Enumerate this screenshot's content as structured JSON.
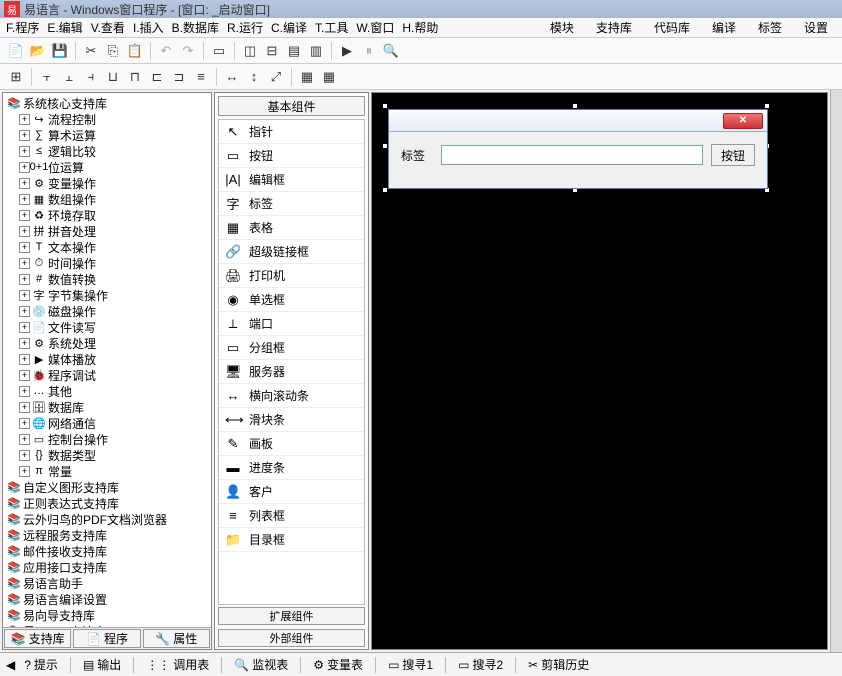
{
  "title": "易语言 - Windows窗口程序 - [窗口: _启动窗口]",
  "menu": [
    "F.程序",
    "E.编辑",
    "V.查看",
    "I.插入",
    "B.数据库",
    "R.运行",
    "C.编译",
    "T.工具",
    "W.窗口",
    "H.帮助"
  ],
  "menu_right": [
    "模块",
    "支持库",
    "代码库",
    "编译",
    "标签",
    "设置"
  ],
  "left_root": "系统核心支持库",
  "left_children": [
    "流程控制",
    "算术运算",
    "逻辑比较",
    "位运算",
    "变量操作",
    "数组操作",
    "环境存取",
    "拼音处理",
    "文本操作",
    "时间操作",
    "数值转换",
    "字节集操作",
    "磁盘操作",
    "文件读写",
    "系统处理",
    "媒体播放",
    "程序调试",
    "其他",
    "数据库",
    "网络通信",
    "控制台操作",
    "数据类型",
    "常量"
  ],
  "left_libs": [
    "自定义图形支持库",
    "正则表达式支持库",
    "云外归鸟的PDF文档浏览器",
    "远程服务支持库",
    "邮件接收支持库",
    "应用接口支持库",
    "易语言助手",
    "易语言编译设置",
    "易向导支持库",
    "易LOGO支持库"
  ],
  "left_tabs": [
    "支持库",
    "程序",
    "属性"
  ],
  "mid_header": "基本组件",
  "components": [
    {
      "icon": "↖",
      "label": "指针"
    },
    {
      "icon": "▭",
      "label": "按钮"
    },
    {
      "icon": "|A|",
      "label": "编辑框"
    },
    {
      "icon": "字",
      "label": "标签"
    },
    {
      "icon": "▦",
      "label": "表格"
    },
    {
      "icon": "🔗",
      "label": "超级链接框"
    },
    {
      "icon": "🖨",
      "label": "打印机"
    },
    {
      "icon": "◉",
      "label": "单选框"
    },
    {
      "icon": "⟂",
      "label": "端口"
    },
    {
      "icon": "▭",
      "label": "分组框"
    },
    {
      "icon": "🖥",
      "label": "服务器"
    },
    {
      "icon": "↔",
      "label": "横向滚动条"
    },
    {
      "icon": "⟷",
      "label": "滑块条"
    },
    {
      "icon": "✎",
      "label": "画板"
    },
    {
      "icon": "▬",
      "label": "进度条"
    },
    {
      "icon": "👤",
      "label": "客户"
    },
    {
      "icon": "≡",
      "label": "列表框"
    },
    {
      "icon": "📁",
      "label": "目录框"
    }
  ],
  "mid_footer": [
    "扩展组件",
    "外部组件"
  ],
  "form": {
    "label": "标签",
    "button": "按钮"
  },
  "bottom": [
    "提示",
    "输出",
    "调用表",
    "监视表",
    "变量表",
    "搜寻1",
    "搜寻2",
    "剪辑历史"
  ]
}
